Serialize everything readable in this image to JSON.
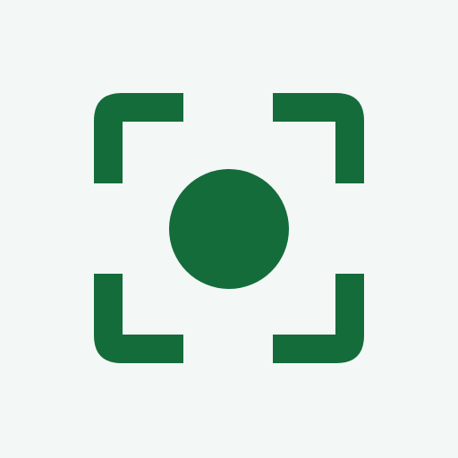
{
  "icon": {
    "name": "focus-capture-icon",
    "background_color": "#f3f7f6",
    "foreground_color": "#146c3a"
  }
}
